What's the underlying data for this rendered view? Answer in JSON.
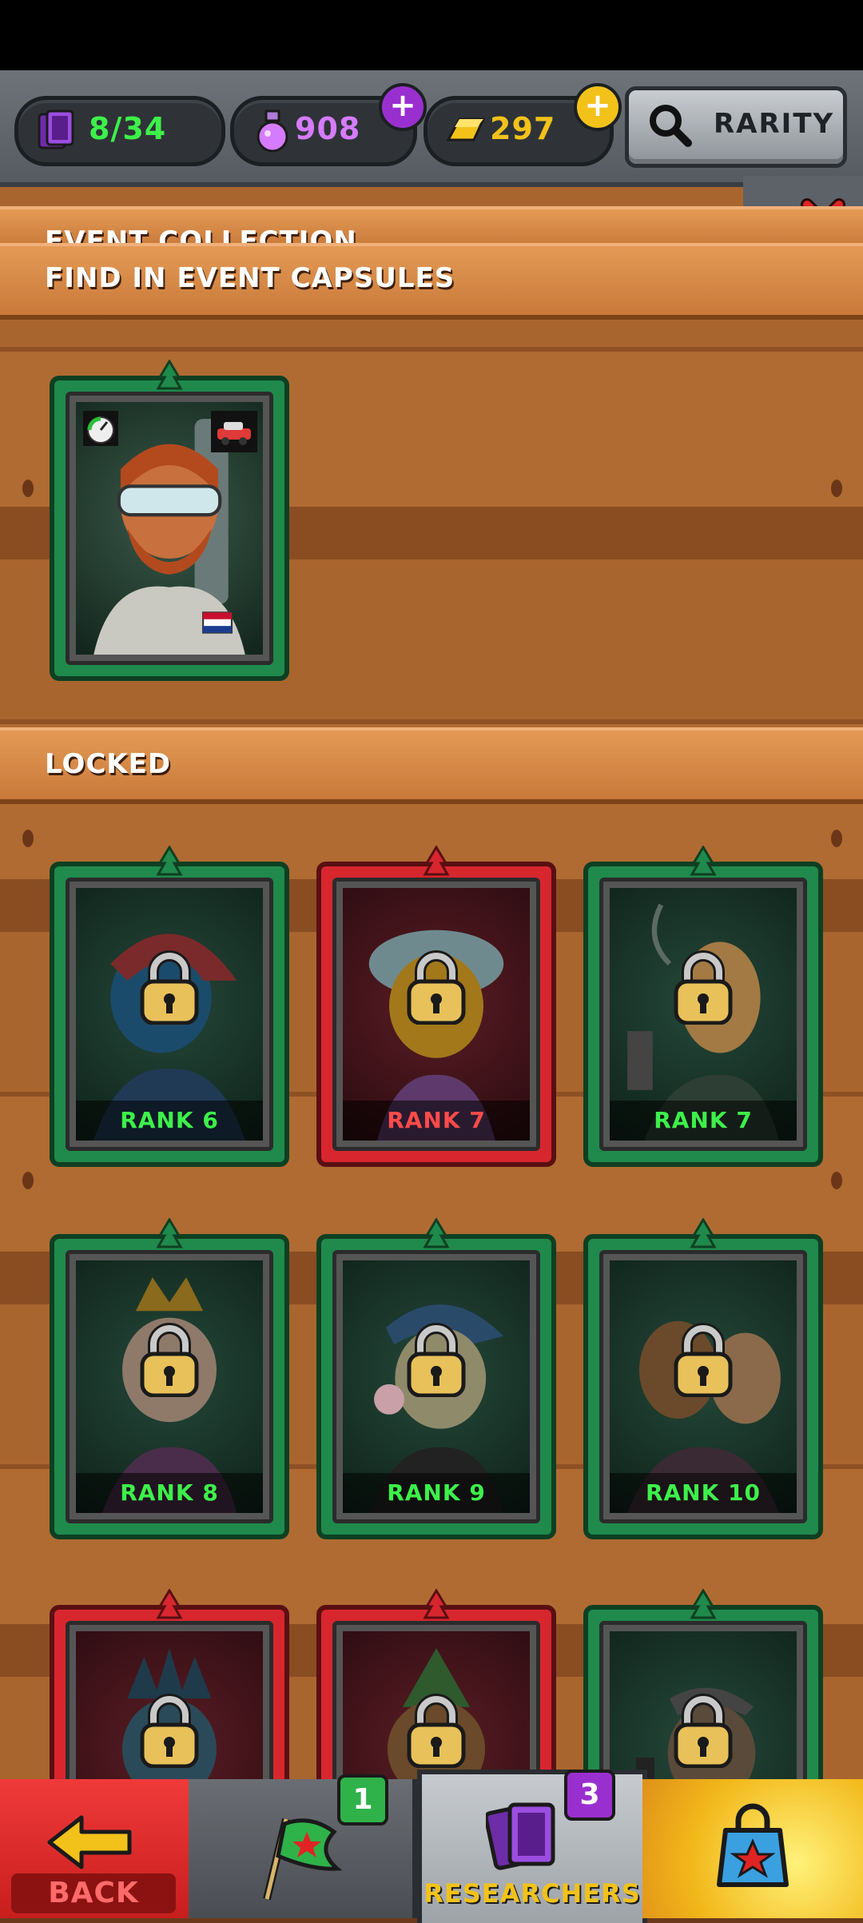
{
  "topbar": {
    "cards_count": "8/34",
    "potion_count": "908",
    "gold_count": "297",
    "rarity_label": "RARITY"
  },
  "sections": {
    "event_collection_title": "EVENT COLLECTION",
    "event_capsules_title": "FIND IN EVENT CAPSULES",
    "locked_title": "LOCKED"
  },
  "locked_cards": [
    {
      "rank": "RANK 6",
      "frame": "green"
    },
    {
      "rank": "RANK 7",
      "frame": "red"
    },
    {
      "rank": "RANK 7",
      "frame": "green"
    },
    {
      "rank": "RANK 8",
      "frame": "green"
    },
    {
      "rank": "RANK 9",
      "frame": "green"
    },
    {
      "rank": "RANK 10",
      "frame": "green"
    }
  ],
  "bottom_nav": {
    "back_label": "BACK",
    "flag_badge": "1",
    "researchers_label": "RESEARCHERS",
    "researchers_badge": "3"
  },
  "colors": {
    "accent_green": "#3df04a",
    "accent_red": "#ff4a4a",
    "potion_purple": "#d57bff",
    "gold": "#f2c21a"
  }
}
